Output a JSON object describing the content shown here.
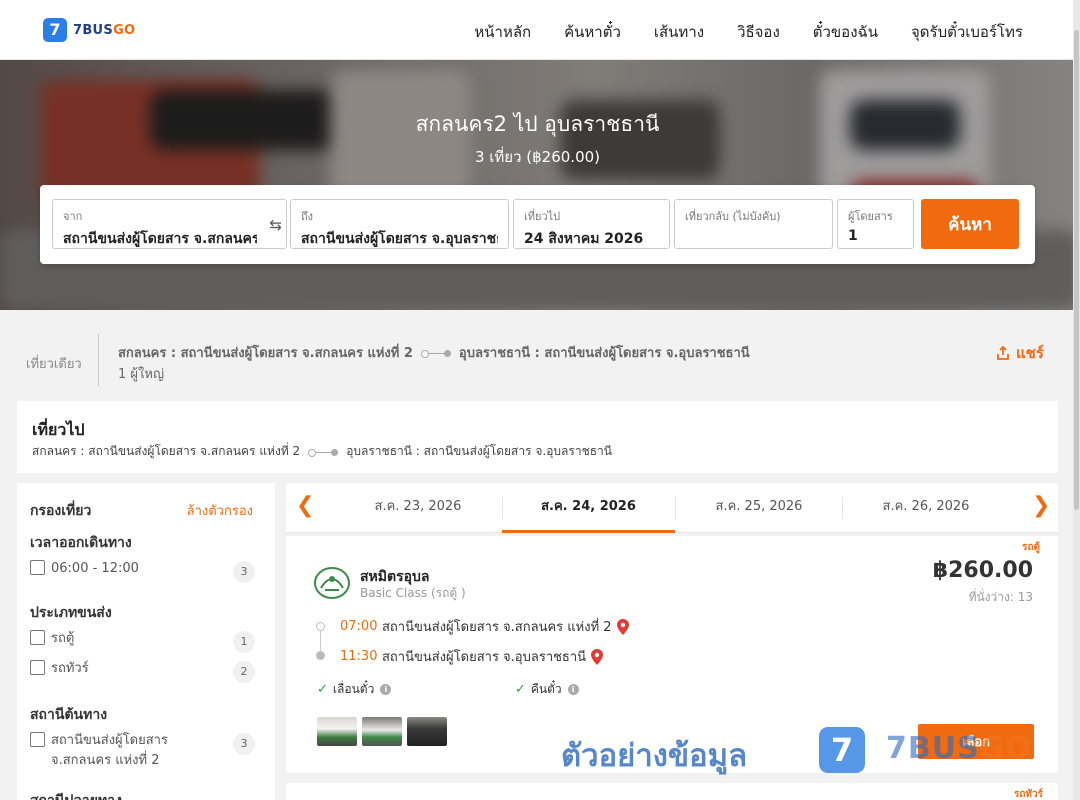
{
  "header": {
    "logo_mark": "7",
    "logo_text_a": "7BUS",
    "logo_text_b": "GO",
    "nav": [
      "หน้าหลัก",
      "ค้นหาตั๋ว",
      "เส้นทาง",
      "วิธีจอง",
      "ตั๋วของฉัน",
      "จุดรับตั๋วเบอร์โทร"
    ]
  },
  "hero": {
    "title": "สกลนคร2 ไป อุบลราชธานี",
    "subtitle": "3 เที่ยว (฿260.00)"
  },
  "search": {
    "from_label": "จาก",
    "from_value": "สถานีขนส่งผู้โดยสาร จ.สกลนคร",
    "to_label": "ถึง",
    "to_value": "สถานีขนส่งผู้โดยสาร จ.อุบลราชธานี",
    "depart_label": "เที่ยวไป",
    "depart_value": "24 สิงหาคม 2026",
    "return_label": "เที่ยวกลับ (ไม่บังคับ)",
    "return_value": "",
    "pax_label": "ผู้โดยสาร",
    "pax_value": "1",
    "button": "ค้นหา"
  },
  "summary": {
    "trip_type": "เที่ยวเดียว",
    "origin": "สกลนคร : สถานีขนส่งผู้โดยสาร จ.สกลนคร แห่งที่ 2",
    "destination": "อุบลราชธานี : สถานีขนส่งผู้โดยสาร จ.อุบลราชธานี",
    "passengers": "1 ผู้ใหญ่",
    "share": "แชร์"
  },
  "outbound": {
    "title": "เที่ยวไป",
    "origin": "สกลนคร : สถานีขนส่งผู้โดยสาร จ.สกลนคร แห่งที่ 2",
    "destination": "อุบลราชธานี : สถานีขนส่งผู้โดยสาร จ.อุบลราชธานี"
  },
  "filter": {
    "title": "กรองเที่ยว",
    "clear": "ล้างตัวกรอง",
    "departure_time": {
      "title": "เวลาออกเดินทาง",
      "options": [
        {
          "label": "06:00 - 12:00",
          "count": "3"
        }
      ]
    },
    "transport_type": {
      "title": "ประเภทขนส่ง",
      "options": [
        {
          "label": "รถตู้",
          "count": "1"
        },
        {
          "label": "รถทัวร์",
          "count": "2"
        }
      ]
    },
    "origin_station": {
      "title": "สถานีต้นทาง",
      "options": [
        {
          "label": "สถานีขนส่งผู้โดยสาร จ.สกลนคร แห่งที่ 2",
          "count": "3"
        }
      ]
    },
    "dest_station_title": "สถานีปลายทาง"
  },
  "dates": {
    "tabs": [
      "ส.ค. 23, 2026",
      "ส.ค. 24, 2026",
      "ส.ค. 25, 2026",
      "ส.ค. 26, 2026"
    ],
    "active_index": 1
  },
  "trips": [
    {
      "tag": "รถตู้",
      "operator": "สหมิตรอุบล",
      "class": "Basic Class (รถตู้ )",
      "price": "฿260.00",
      "seats": "ที่นั่งว่าง: 13",
      "depart_time": "07:00",
      "depart_station": "สถานีขนส่งผู้โดยสาร จ.สกลนคร แห่งที่ 2",
      "arrive_time": "11:30",
      "arrive_station": "สถานีขนส่งผู้โดยสาร จ.อุบลราชธานี",
      "perk1": "เลื่อนตั๋ว",
      "perk2": "คืนตั๋ว",
      "select": "เลือก"
    },
    {
      "tag": "รถทัวร์"
    }
  ],
  "watermark": {
    "text": "ตัวอย่างข้อมูล",
    "brand_a": "7BUS",
    "brand_b": "GO"
  },
  "colors": {
    "accent": "#f26a0f",
    "brand_blue": "#2b7de9",
    "check_green": "#2e9e45"
  }
}
